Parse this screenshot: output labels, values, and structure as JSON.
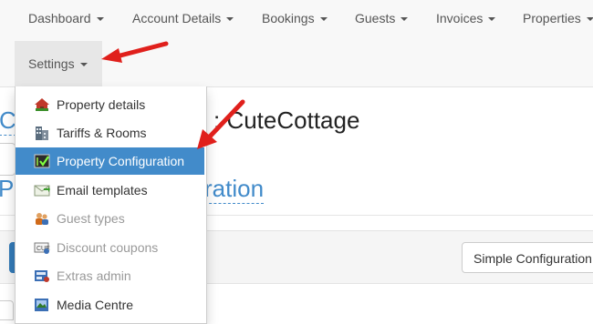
{
  "navbar": {
    "items": [
      {
        "label": "Dashboard"
      },
      {
        "label": "Account Details"
      },
      {
        "label": "Bookings"
      },
      {
        "label": "Guests"
      },
      {
        "label": "Invoices"
      },
      {
        "label": "Properties"
      }
    ],
    "settings": {
      "label": "Settings"
    }
  },
  "page": {
    "heading_left": "C",
    "heading_right": ": CuteCottage",
    "subheading_left": "P",
    "subheading_right": "ration",
    "simple_button_label": "Simple Configuration"
  },
  "settings_menu": {
    "items": [
      {
        "label": "Property details",
        "icon": "house-icon",
        "state": "normal"
      },
      {
        "label": "Tariffs & Rooms",
        "icon": "building-icon",
        "state": "normal"
      },
      {
        "label": "Property Configuration",
        "icon": "checkbox-panel-icon",
        "state": "active"
      },
      {
        "label": "Email templates",
        "icon": "envelope-icon",
        "state": "normal"
      },
      {
        "label": "Guest types",
        "icon": "people-icon",
        "state": "disabled"
      },
      {
        "label": "Discount coupons",
        "icon": "coupon-icon",
        "state": "disabled"
      },
      {
        "label": "Extras admin",
        "icon": "extras-icon",
        "state": "disabled"
      },
      {
        "label": "Media Centre",
        "icon": "media-icon",
        "state": "normal"
      }
    ]
  },
  "colors": {
    "link_blue": "#428bca",
    "active_bg": "#428bca",
    "arrow_red": "#e0201c"
  }
}
